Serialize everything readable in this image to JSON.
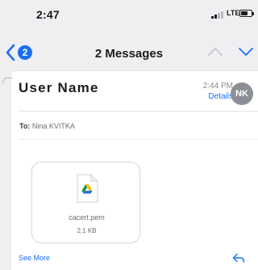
{
  "status_bar": {
    "time": "2:47",
    "network": "LTE",
    "icons": [
      "signal-icon",
      "battery-icon"
    ]
  },
  "nav": {
    "back_icon": "chevron-left-icon",
    "unread_count": "2",
    "title": "2 Messages",
    "prev_icon": "chevron-up-icon",
    "next_icon": "chevron-down-icon"
  },
  "message": {
    "sender": "User Name",
    "time": "2:44 PM",
    "details_label": "Details",
    "avatar_initials": "NK",
    "to_label": "To:",
    "to_name": "Nina KVITKA",
    "attachment": {
      "icon": "google-drive-file-icon",
      "name": "cacert.pem",
      "size": "2.1 KB"
    },
    "see_more_label": "See More",
    "reply_icon": "reply-icon"
  },
  "colors": {
    "accent": "#1a6ff5",
    "background": "#efeff2",
    "card": "#ffffff",
    "avatar": "#8d8f96"
  }
}
